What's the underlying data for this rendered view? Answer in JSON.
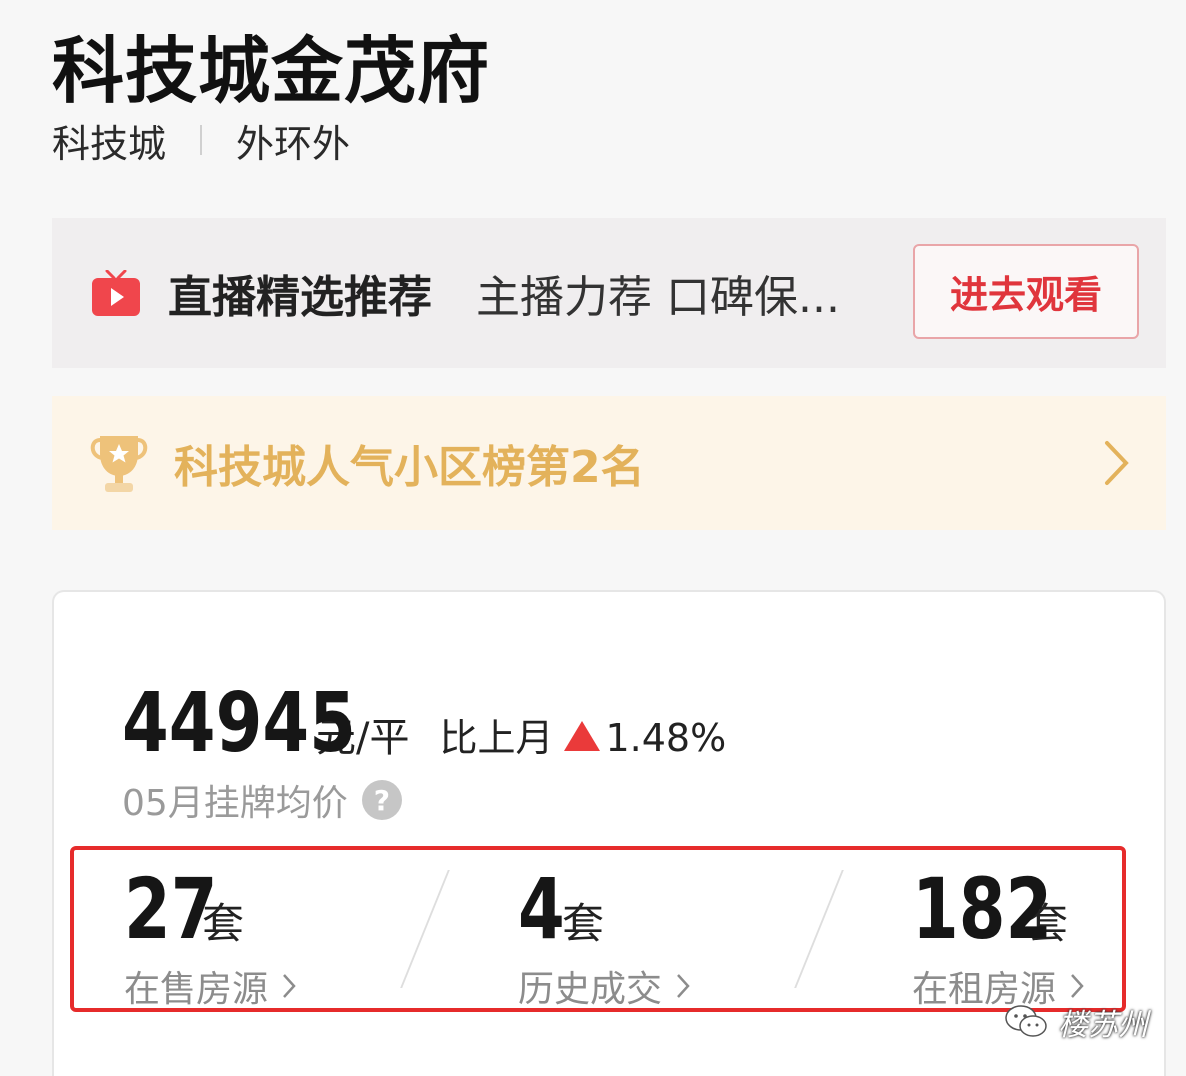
{
  "header": {
    "title": "科技城金茂府",
    "district": "科技城",
    "ring": "外环外"
  },
  "live": {
    "icon": "tv-icon",
    "title": "直播精选推荐",
    "desc": "主播力荐 口碑保...",
    "button": "进去观看",
    "colors": {
      "accent": "#e0353c",
      "icon": "#f0464c"
    }
  },
  "rank": {
    "icon": "trophy-icon",
    "text": "科技城人气小区榜第2名",
    "color": "#e3b25b"
  },
  "price": {
    "value": "44945",
    "unit": "元/平",
    "mom_label": "比上月",
    "mom_direction": "up",
    "mom_value": "1.48%",
    "caption": "05月挂牌均价",
    "help_icon": "?"
  },
  "stats": [
    {
      "num": "27",
      "unit": "套",
      "label": "在售房源"
    },
    {
      "num": "4",
      "unit": "套",
      "label": "历史成交"
    },
    {
      "num": "182",
      "unit": "套",
      "label": "在租房源"
    }
  ],
  "watermark": {
    "text": "楼苏州",
    "icon": "wechat-icon"
  }
}
